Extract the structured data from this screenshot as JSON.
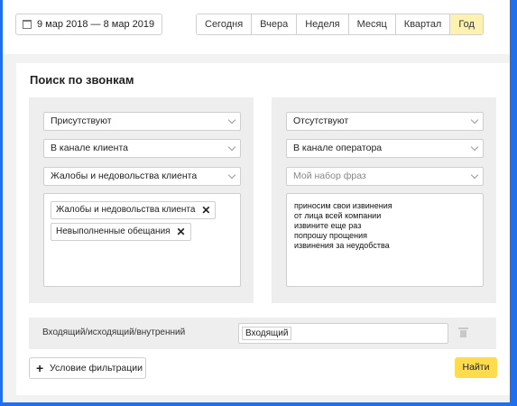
{
  "date_range": "9 мар 2018 — 8 мар 2019",
  "periods": [
    "Сегодня",
    "Вчера",
    "Неделя",
    "Месяц",
    "Квартал",
    "Год"
  ],
  "active_period": "Год",
  "title": "Поиск по звонкам",
  "left": {
    "presence": "Присутствуют",
    "channel": "В канале клиента",
    "phrase_set": "Жалобы и недовольства клиента",
    "tags": [
      "Жалобы и недовольства клиента",
      "Невыполненные обещания"
    ]
  },
  "right": {
    "presence": "Отсутствуют",
    "channel": "В канале оператора",
    "phrase_set_placeholder": "Мой набор фраз",
    "phrases": [
      "приносим свои извинения",
      "от лица всей компании",
      "извините еще раз",
      "попрошу прощения",
      "извинения за неудобства"
    ]
  },
  "direction": {
    "label": "Входящий/исходящий/внутренний",
    "value": "Входящий"
  },
  "buttons": {
    "add_filter": "Условие фильтрации",
    "find": "Найти"
  },
  "icons": {
    "calendar": "calendar-icon",
    "chevron": "chevron-down-icon",
    "remove": "close-icon",
    "trash": "trash-icon",
    "plus": "plus-icon"
  },
  "colors": {
    "background": "#1f6ff0",
    "active_period": "#fff1b0",
    "find_button": "#ffdb4d"
  }
}
